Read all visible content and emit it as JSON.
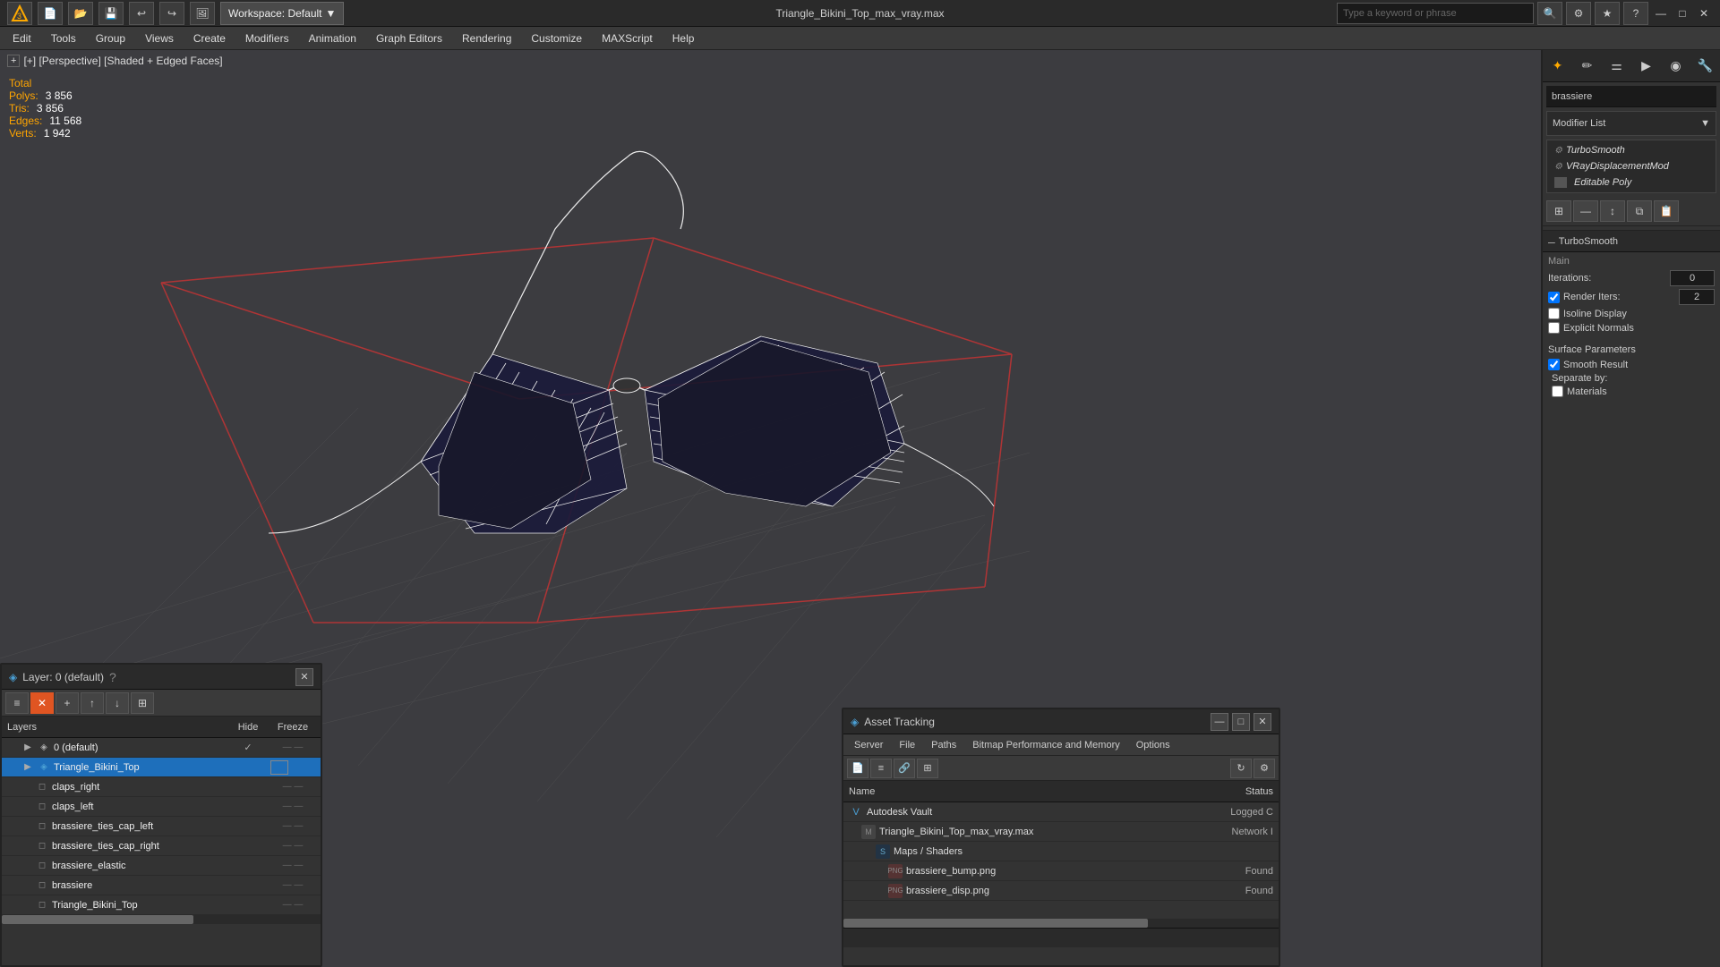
{
  "titlebar": {
    "title": "Triangle_Bikini_Top_max_vray.max",
    "workspace_label": "Workspace: Default",
    "search_placeholder": "Type a keyword or phrase",
    "close": "✕",
    "maximize": "□",
    "minimize": "—"
  },
  "menubar": {
    "items": [
      "Edit",
      "Tools",
      "Group",
      "Views",
      "Create",
      "Modifiers",
      "Animation",
      "Graph Editors",
      "Rendering",
      "Customize",
      "MAXScript",
      "Help"
    ]
  },
  "viewport": {
    "label": "[+] [Perspective] [Shaded + Edged Faces]",
    "stats": {
      "total_label": "Total",
      "polys_label": "Polys:",
      "polys_value": "3 856",
      "tris_label": "Tris:",
      "tris_value": "3 856",
      "edges_label": "Edges:",
      "edges_value": "11 568",
      "verts_label": "Verts:",
      "verts_value": "1 942"
    }
  },
  "right_panel": {
    "search_placeholder": "brassiere",
    "modifier_list_label": "Modifier List",
    "modifiers": [
      {
        "name": "TurboSmooth",
        "icon": "T"
      },
      {
        "name": "VRayDisplacementMod",
        "icon": "V"
      },
      {
        "name": "Editable Poly",
        "icon": "E"
      }
    ],
    "turbosm": {
      "title": "TurboSmooth",
      "main_label": "Main",
      "iterations_label": "Iterations:",
      "iterations_value": "0",
      "render_iters_label": "Render Iters:",
      "render_iters_value": "2",
      "isoline_display_label": "Isoline Display",
      "explicit_normals_label": "Explicit Normals",
      "surface_params_label": "Surface Parameters",
      "smooth_result_label": "Smooth Result",
      "smooth_result_checked": true,
      "separate_by_label": "Separate by:",
      "materials_label": "Materials"
    }
  },
  "layers": {
    "window_title": "Layer: 0 (default)",
    "panel_title": "Layers",
    "col_hide": "Hide",
    "col_freeze": "Freeze",
    "items": [
      {
        "name": "0 (default)",
        "indent": 0,
        "active": true,
        "check": "✓"
      },
      {
        "name": "Triangle_Bikini_Top",
        "indent": 1,
        "selected": true
      },
      {
        "name": "claps_right",
        "indent": 2
      },
      {
        "name": "claps_left",
        "indent": 2
      },
      {
        "name": "brassiere_ties_cap_left",
        "indent": 2
      },
      {
        "name": "brassiere_ties_cap_right",
        "indent": 2
      },
      {
        "name": "brassiere_elastic",
        "indent": 2
      },
      {
        "name": "brassiere",
        "indent": 2
      },
      {
        "name": "Triangle_Bikini_Top",
        "indent": 2
      }
    ]
  },
  "asset_tracking": {
    "window_title": "Asset Tracking",
    "panel_title": "Asset Tracking",
    "menu_items": [
      "Server",
      "File",
      "Paths",
      "Bitmap Performance and Memory",
      "Options"
    ],
    "col_name": "Name",
    "col_status": "Status",
    "items": [
      {
        "name": "Autodesk Vault",
        "indent": 0,
        "status": "Logged C",
        "icon": "V"
      },
      {
        "name": "Triangle_Bikini_Top_max_vray.max",
        "indent": 1,
        "status": "Network I",
        "icon": "M"
      },
      {
        "name": "Maps / Shaders",
        "indent": 2,
        "status": "",
        "icon": "S"
      },
      {
        "name": "brassiere_bump.png",
        "indent": 3,
        "status": "Found",
        "icon": "P"
      },
      {
        "name": "brassiere_disp.png",
        "indent": 3,
        "status": "Found",
        "icon": "P"
      }
    ]
  }
}
